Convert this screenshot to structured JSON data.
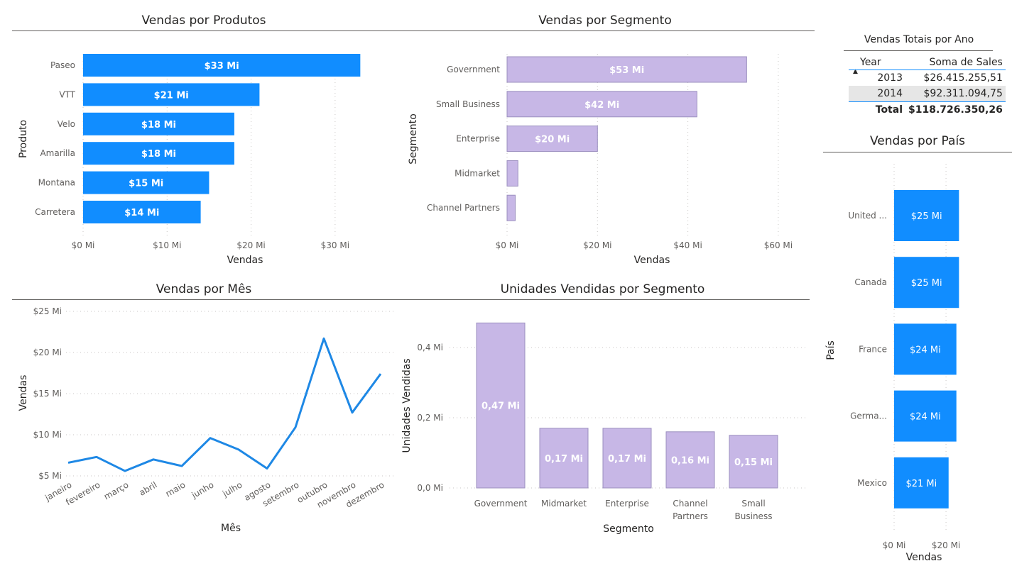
{
  "colors": {
    "blue": "#118dff",
    "purple": "#c7b7e6",
    "purple_border": "#9b8fbf",
    "line": "#1e88e5"
  },
  "chart_data": [
    {
      "type": "bar",
      "orientation": "horizontal",
      "title": "Vendas por Produtos",
      "categories": [
        "Paseo",
        "VTT",
        "Velo",
        "Amarilla",
        "Montana",
        "Carretera"
      ],
      "values": [
        33,
        21,
        18,
        18,
        15,
        14
      ],
      "value_labels": [
        "$33 Mi",
        "$21 Mi",
        "$18 Mi",
        "$18 Mi",
        "$15 Mi",
        "$14 Mi"
      ],
      "xlabel": "Vendas",
      "ylabel": "Produto",
      "xlim": [
        0,
        35
      ],
      "x_ticks": [
        0,
        10,
        20,
        30
      ],
      "x_tick_labels": [
        "$0 Mi",
        "$10 Mi",
        "$20 Mi",
        "$30 Mi"
      ]
    },
    {
      "type": "bar",
      "orientation": "horizontal",
      "title": "Vendas por Segmento",
      "categories": [
        "Government",
        "Small Business",
        "Enterprise",
        "Midmarket",
        "Channel Partners"
      ],
      "values": [
        53,
        42,
        20,
        2.4,
        1.8
      ],
      "value_labels": [
        "$53 Mi",
        "$42 Mi",
        "$20 Mi",
        "",
        ""
      ],
      "xlabel": "Vendas",
      "ylabel": "Segmento",
      "xlim": [
        0,
        63
      ],
      "x_ticks": [
        0,
        20,
        40,
        60
      ],
      "x_tick_labels": [
        "$0 Mi",
        "$20 Mi",
        "$40 Mi",
        "$60 Mi"
      ]
    },
    {
      "type": "line",
      "title": "Vendas por Mês",
      "categories": [
        "janeiro",
        "fevereiro",
        "março",
        "abril",
        "maio",
        "junho",
        "julho",
        "agosto",
        "setembro",
        "outubro",
        "novembro",
        "dezembro"
      ],
      "values": [
        6.6,
        7.3,
        5.6,
        7.0,
        6.2,
        9.6,
        8.2,
        5.9,
        10.9,
        21.7,
        12.7,
        17.4
      ],
      "xlabel": "Mês",
      "ylabel": "Vendas",
      "ylim": [
        5,
        25
      ],
      "y_ticks": [
        5,
        10,
        15,
        20,
        25
      ],
      "y_tick_labels": [
        "$5 Mi",
        "$10 Mi",
        "$15 Mi",
        "$20 Mi",
        "$25 Mi"
      ]
    },
    {
      "type": "bar",
      "orientation": "vertical",
      "title": "Unidades Vendidas por Segmento",
      "categories": [
        "Government",
        "Midmarket",
        "Enterprise",
        "Channel Partners",
        "Small Business"
      ],
      "values": [
        0.47,
        0.17,
        0.17,
        0.16,
        0.15
      ],
      "value_labels": [
        "0,47 Mi",
        "0,17 Mi",
        "0,17 Mi",
        "0,16 Mi",
        "0,15 Mi"
      ],
      "xlabel": "Segmento",
      "ylabel": "Unidades Vendidas",
      "ylim": [
        0,
        0.5
      ],
      "y_ticks": [
        0,
        0.2,
        0.4
      ],
      "y_tick_labels": [
        "0,0 Mi",
        "0,2 Mi",
        "0,4 Mi"
      ]
    },
    {
      "type": "bar",
      "orientation": "horizontal",
      "title": "Vendas por País",
      "categories": [
        "United ...",
        "Canada",
        "France",
        "Germa...",
        "Mexico"
      ],
      "values": [
        25,
        25,
        24,
        24,
        21
      ],
      "value_labels": [
        "$25 Mi",
        "$25 Mi",
        "$24 Mi",
        "$24 Mi",
        "$21 Mi"
      ],
      "xlabel": "Vendas",
      "ylabel": "País",
      "xlim": [
        0,
        26
      ],
      "x_ticks": [
        0,
        20
      ],
      "x_tick_labels": [
        "$0 Mi",
        "$20 Mi"
      ]
    }
  ],
  "table": {
    "title": "Vendas Totais por Ano",
    "col_year": "Year",
    "col_sales": "Soma de Sales",
    "rows": [
      {
        "year": "2013",
        "sales": "$26.415.255,51"
      },
      {
        "year": "2014",
        "sales": "$92.311.094,75"
      }
    ],
    "total_label": "Total",
    "total_value": "$118.726.350,26"
  }
}
